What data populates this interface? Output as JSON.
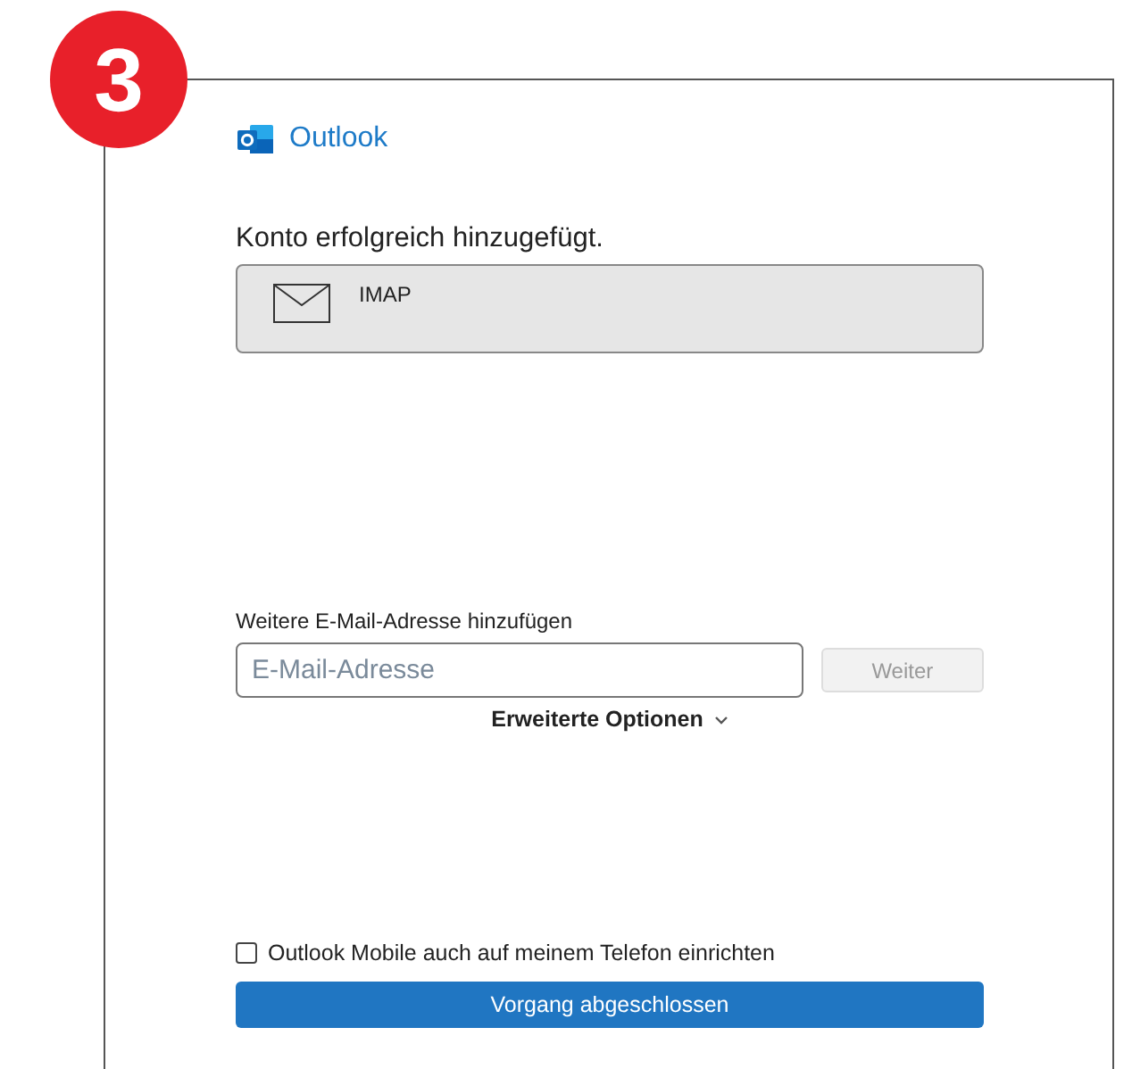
{
  "step_badge": "3",
  "app": {
    "name": "Outlook"
  },
  "heading": "Konto erfolgreich hinzugefügt.",
  "account": {
    "type": "IMAP"
  },
  "add_address": {
    "label": "Weitere E-Mail-Adresse hinzufügen",
    "placeholder": "E-Mail-Adresse",
    "next_button": {
      "label": "Weiter",
      "disabled": true
    }
  },
  "advanced_options": {
    "label": "Erweiterte Optionen",
    "expanded": false
  },
  "mobile_setup": {
    "label": "Outlook Mobile auch auf meinem Telefon einrichten",
    "checked": false
  },
  "done_button": "Vorgang abgeschlossen"
}
